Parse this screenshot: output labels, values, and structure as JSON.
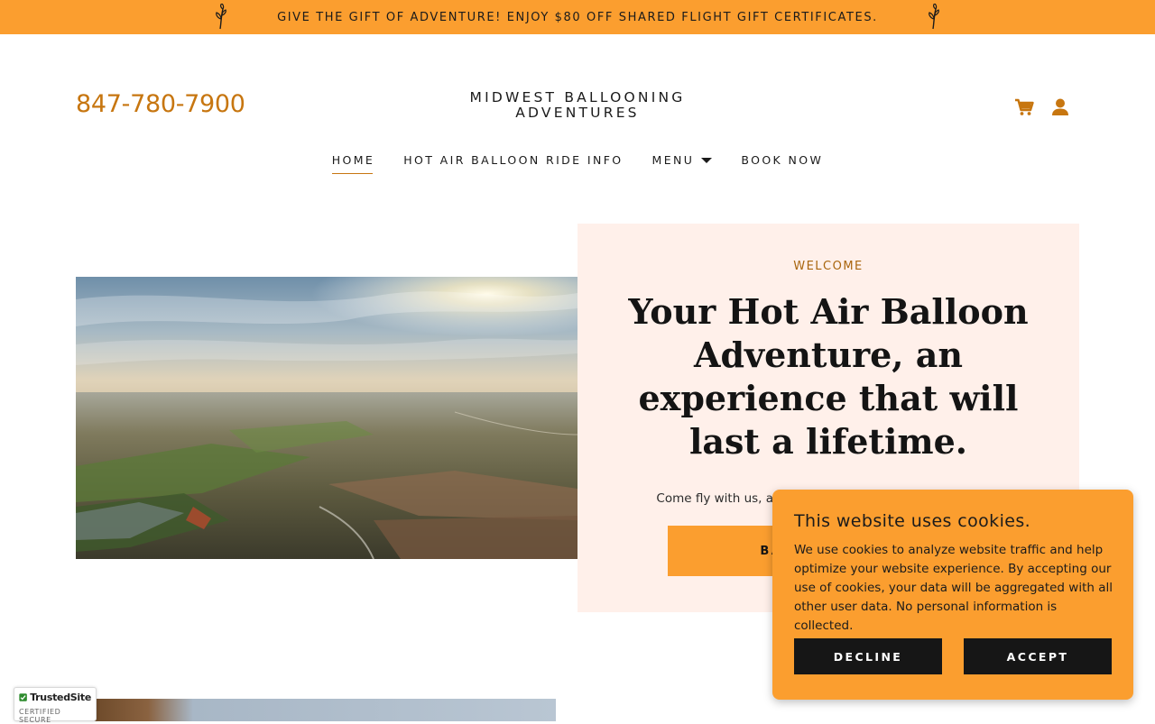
{
  "announcement": {
    "text": "GIVE THE GIFT OF ADVENTURE! ENJOY $80 OFF SHARED FLIGHT GIFT CERTIFICATES."
  },
  "header": {
    "phone": "847-780-7900",
    "brand_line1": "MIDWEST BALLOONING",
    "brand_line2": "ADVENTURES",
    "icons": [
      "cart-icon",
      "account-icon"
    ],
    "accent_color": "#c77610"
  },
  "nav": {
    "items": [
      {
        "label": "HOME",
        "active": true
      },
      {
        "label": "HOT AIR BALLOON RIDE INFO",
        "active": false
      },
      {
        "label": "MENU",
        "active": false
      },
      {
        "label": "BOOK NOW",
        "active": false
      }
    ]
  },
  "hero": {
    "eyebrow": "WELCOME",
    "headline": "Your Hot Air Balloon Adventure, an experience that will last a lifetime.",
    "subtext": "Come fly with us, a family owned Chicagoland company.",
    "cta_label": "BALLOON RIDES",
    "panel_color": "#fff0ea"
  },
  "cookie_banner": {
    "title": "This website uses cookies.",
    "body": "We use cookies to analyze website traffic and help optimize your website experience. By accepting our use of cookies, your data will be aggregated with all other user data. No personal information is collected.",
    "decline_label": "DECLINE",
    "accept_label": "ACCEPT",
    "background": "#fb9e2f"
  },
  "trust_badge": {
    "name": "TrustedSite",
    "subtitle": "CERTIFIED SECURE"
  },
  "colors": {
    "promo_bar": "#fb9e2f",
    "button_dark": "#161616"
  }
}
